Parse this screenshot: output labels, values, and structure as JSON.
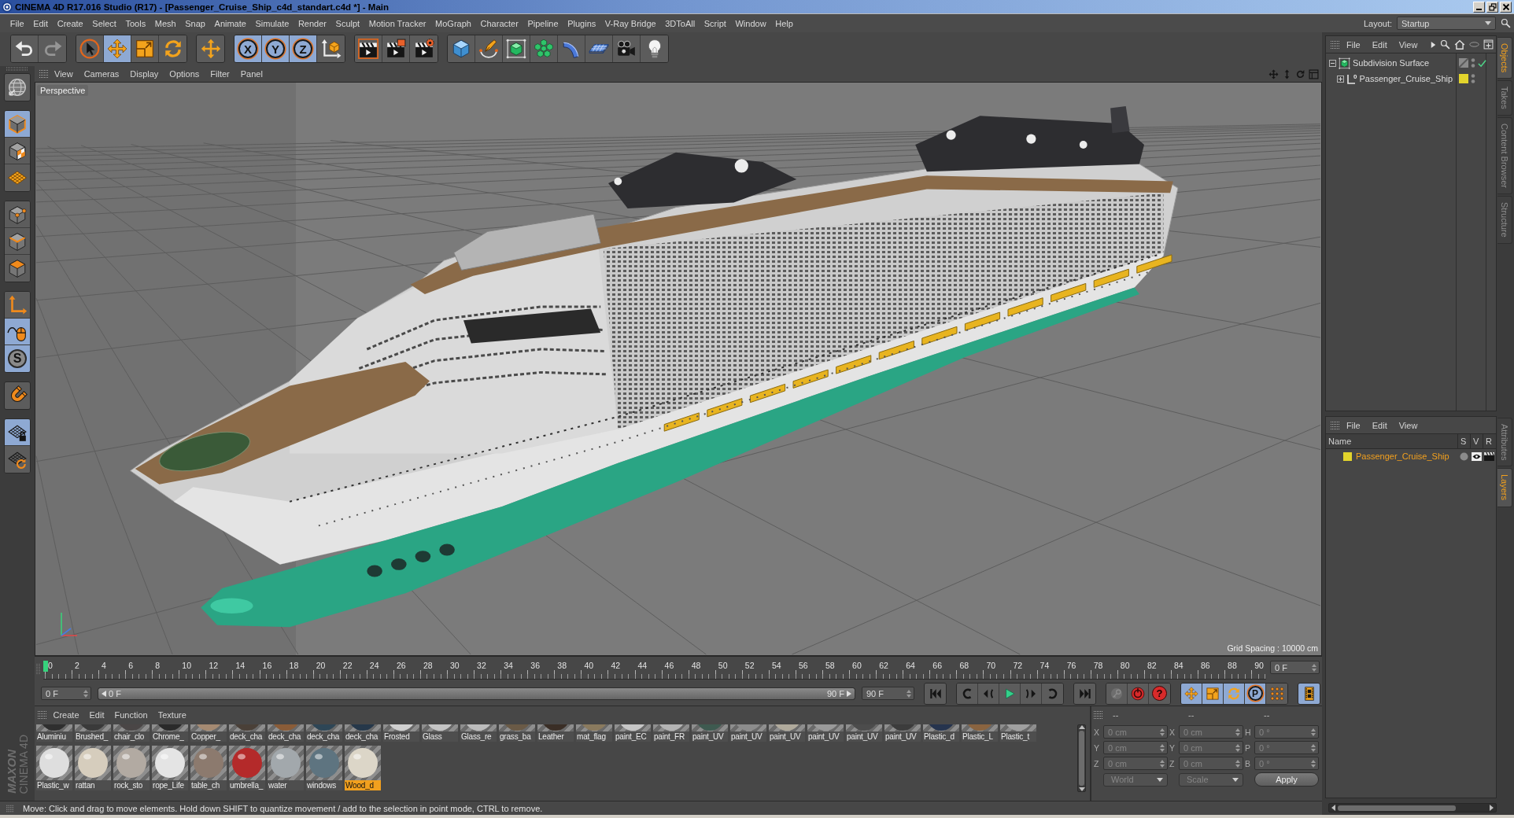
{
  "window": {
    "title": "CINEMA 4D R17.016 Studio (R17) - [Passenger_Cruise_Ship_c4d_standart.c4d *] - Main"
  },
  "menu_bar": {
    "items": [
      "File",
      "Edit",
      "Create",
      "Select",
      "Tools",
      "Mesh",
      "Snap",
      "Animate",
      "Simulate",
      "Render",
      "Sculpt",
      "Motion Tracker",
      "MoGraph",
      "Character",
      "Pipeline",
      "Plugins",
      "V-Ray Bridge",
      "3DToAll",
      "Script",
      "Window",
      "Help"
    ],
    "layout_label": "Layout:",
    "layout_value": "Startup"
  },
  "toolbar": {
    "groups": [
      [
        {
          "kind": "undo",
          "selected": false,
          "disabled": false
        },
        {
          "kind": "redo",
          "selected": false,
          "disabled": true
        }
      ],
      [
        {
          "kind": "select",
          "selected": false,
          "disabled": false
        },
        {
          "kind": "move",
          "selected": true,
          "disabled": false
        },
        {
          "kind": "scale",
          "selected": false,
          "disabled": false
        },
        {
          "kind": "rotate",
          "selected": false,
          "disabled": false
        }
      ],
      [
        {
          "kind": "add",
          "selected": false,
          "disabled": false
        }
      ],
      [
        {
          "kind": "axis",
          "label": "X",
          "selected": true,
          "disabled": false
        },
        {
          "kind": "axis",
          "label": "Y",
          "selected": true,
          "disabled": false
        },
        {
          "kind": "axis",
          "label": "Z",
          "selected": true,
          "disabled": false
        },
        {
          "kind": "coordinates",
          "selected": false,
          "disabled": false
        }
      ],
      [
        {
          "kind": "render-view",
          "selected": false,
          "disabled": false
        },
        {
          "kind": "render-picture",
          "selected": false,
          "disabled": false
        },
        {
          "kind": "render-settings",
          "selected": false,
          "disabled": false
        }
      ],
      [
        {
          "kind": "cube",
          "selected": false,
          "disabled": false
        },
        {
          "kind": "pen",
          "selected": false,
          "disabled": false
        },
        {
          "kind": "subdivision",
          "selected": false,
          "disabled": false
        },
        {
          "kind": "cloner",
          "selected": false,
          "disabled": false
        },
        {
          "kind": "deformer",
          "selected": false,
          "disabled": false
        },
        {
          "kind": "floor",
          "selected": false,
          "disabled": false
        },
        {
          "kind": "camera",
          "selected": false,
          "disabled": false
        },
        {
          "kind": "light",
          "selected": false,
          "disabled": false
        }
      ]
    ]
  },
  "palette": {
    "groups": [
      [
        {
          "kind": "globe",
          "selected": false
        }
      ],
      [
        {
          "kind": "model",
          "selected": true
        },
        {
          "kind": "texture",
          "selected": false
        },
        {
          "kind": "workplane",
          "selected": false
        }
      ],
      [
        {
          "kind": "points",
          "selected": false
        },
        {
          "kind": "edges",
          "selected": false
        },
        {
          "kind": "polygons",
          "selected": false
        }
      ],
      [
        {
          "kind": "axis",
          "selected": false
        },
        {
          "kind": "tweak",
          "selected": true
        },
        {
          "kind": "snap",
          "glyph": "S",
          "selected": true
        }
      ],
      [
        {
          "kind": "magnet",
          "selected": false
        }
      ],
      [
        {
          "kind": "grid-lock",
          "selected": true
        },
        {
          "kind": "grid-rotate",
          "selected": false
        }
      ]
    ],
    "brand": {
      "company": "MAXON",
      "product": "CINEMA 4D"
    }
  },
  "viewport": {
    "menu": [
      "View",
      "Cameras",
      "Display",
      "Options",
      "Filter",
      "Panel"
    ],
    "camera": "Perspective",
    "grid_spacing": "Grid Spacing : 10000 cm"
  },
  "timeline": {
    "ruler": [
      "0",
      "2",
      "4",
      "6",
      "8",
      "10",
      "12",
      "14",
      "16",
      "18",
      "20",
      "22",
      "24",
      "26",
      "28",
      "30",
      "32",
      "34",
      "36",
      "38",
      "40",
      "42",
      "44",
      "46",
      "48",
      "50",
      "52",
      "54",
      "56",
      "58",
      "60",
      "62",
      "64",
      "66",
      "68",
      "70",
      "72",
      "74",
      "76",
      "78",
      "80",
      "82",
      "84",
      "86",
      "88",
      "90"
    ],
    "current_frame": "0 F",
    "start_field": "0 F",
    "range": {
      "start": "0 F",
      "end": "90 F",
      "level": 1
    },
    "end_field": "90 F",
    "transport": [
      [
        {
          "kind": "go-start"
        }
      ],
      [
        {
          "kind": "prev-key"
        },
        {
          "kind": "prev-frame"
        },
        {
          "kind": "play"
        },
        {
          "kind": "next-frame"
        },
        {
          "kind": "next-key"
        }
      ],
      [
        {
          "kind": "go-end"
        }
      ]
    ],
    "record": [
      {
        "kind": "record-key",
        "disabled": true
      },
      {
        "kind": "autokey",
        "disabled": false
      },
      {
        "kind": "question",
        "glyph": "?",
        "disabled": false
      }
    ],
    "key_tracks": [
      {
        "kind": "move",
        "selected": true
      },
      {
        "kind": "scale",
        "selected": true
      },
      {
        "kind": "rotate",
        "selected": true
      },
      {
        "kind": "param",
        "glyph": "P",
        "selected": true
      },
      {
        "kind": "pla",
        "selected": false
      }
    ],
    "timeline_button": {
      "selected": true
    }
  },
  "materials": {
    "menu": [
      "Create",
      "Edit",
      "Function",
      "Texture"
    ],
    "rows": [
      [
        {
          "name": "Aluminiu",
          "color": "#2f2f2f",
          "selected": false
        },
        {
          "name": "Brushed_",
          "color": "#3a3a3a",
          "selected": false
        },
        {
          "name": "chair_clo",
          "color": "#4a4646",
          "selected": false
        },
        {
          "name": "Chrome_",
          "color": "#2a2a2a",
          "selected": false
        },
        {
          "name": "Copper_",
          "color": "#a58a72",
          "selected": false
        },
        {
          "name": "deck_cha",
          "color": "#4a4038",
          "selected": false
        },
        {
          "name": "deck_cha",
          "color": "#8a5c38",
          "selected": false
        },
        {
          "name": "deck_cha",
          "color": "#2e4656",
          "selected": false
        },
        {
          "name": "deck_cha",
          "color": "#26384a",
          "selected": false
        },
        {
          "name": "Frosted",
          "color": "#cfcfcf",
          "selected": false
        },
        {
          "name": "Glass",
          "color": "#c4c4c4",
          "selected": false
        },
        {
          "name": "Glass_re",
          "color": "#bcbcbc",
          "selected": false
        },
        {
          "name": "grass_ba",
          "color": "#6a5a46",
          "selected": false
        },
        {
          "name": "Leather",
          "color": "#3a2e26",
          "selected": false
        },
        {
          "name": "mat_flag",
          "color": "#8a7a5e",
          "selected": false
        },
        {
          "name": "paint_EC",
          "color": "#c6c6c6",
          "selected": false
        },
        {
          "name": "paint_FR",
          "color": "#b4b4b4",
          "selected": false
        },
        {
          "name": "paint_UV",
          "color": "#3e5a50",
          "selected": false
        },
        {
          "name": "paint_UV",
          "color": "#8c8c8c",
          "selected": false
        },
        {
          "name": "paint_UV",
          "color": "#b0aa9c",
          "selected": false
        },
        {
          "name": "paint_UV",
          "color": "#9a9a9a",
          "selected": false
        },
        {
          "name": "paint_UV",
          "color": "#4c4c4c",
          "selected": false
        },
        {
          "name": "paint_UV",
          "color": "#3c3c3c",
          "selected": false
        },
        {
          "name": "Plastic_d",
          "color": "#26344e",
          "selected": false
        },
        {
          "name": "Plastic_L",
          "color": "#8a6440",
          "selected": false
        },
        {
          "name": "Plastic_t",
          "color": "#a0a0a0",
          "selected": false
        }
      ],
      [
        {
          "name": "Plastic_w",
          "color": "#dedede",
          "selected": false
        },
        {
          "name": "rattan",
          "color": "#d6cdbd",
          "selected": false
        },
        {
          "name": "rock_sto",
          "color": "#b2aaa2",
          "selected": false
        },
        {
          "name": "rope_Life",
          "color": "#e4e4e4",
          "selected": false
        },
        {
          "name": "table_ch",
          "color": "#8c7a6e",
          "selected": false
        },
        {
          "name": "umbrella_",
          "color": "#b42a2a",
          "selected": false
        },
        {
          "name": "water",
          "color": "#a2a8ac",
          "selected": false
        },
        {
          "name": "windows",
          "color": "#5e7480",
          "selected": false
        },
        {
          "name": "Wood_d",
          "color": "#dcd6c8",
          "selected": true
        }
      ]
    ]
  },
  "coordinates": {
    "headers": [
      "--",
      "--",
      "--"
    ],
    "disabled": true,
    "rows": [
      [
        {
          "axis": "X",
          "value": "0 cm"
        },
        {
          "axis": "X",
          "value": "0 cm"
        },
        {
          "axis": "H",
          "value": "0 °"
        }
      ],
      [
        {
          "axis": "Y",
          "value": "0 cm"
        },
        {
          "axis": "Y",
          "value": "0 cm"
        },
        {
          "axis": "P",
          "value": "0 °"
        }
      ],
      [
        {
          "axis": "Z",
          "value": "0 cm"
        },
        {
          "axis": "Z",
          "value": "0 cm"
        },
        {
          "axis": "B",
          "value": "0 °"
        }
      ]
    ],
    "space": "World",
    "transform": "Scale",
    "apply": "Apply"
  },
  "status_bar": {
    "text": "Move: Click and drag to move elements. Hold down SHIFT to quantize movement / add to the selection in point mode, CTRL to remove."
  },
  "objects": {
    "menu": [
      "File",
      "Edit",
      "View"
    ],
    "tree": [
      {
        "name": "Subdivision Surface",
        "kind": "subdivision",
        "expanded": true,
        "enabled": true,
        "children": [
          {
            "name": "Passenger_Cruise_Ship",
            "kind": "null",
            "glyph": "0",
            "expanded": false,
            "color": "#e2d42c"
          }
        ]
      }
    ],
    "tabs": [
      {
        "label": "Objects",
        "selected": true
      },
      {
        "label": "Takes",
        "selected": false
      },
      {
        "label": "Content Browser",
        "selected": false
      },
      {
        "label": "Structure",
        "selected": false
      }
    ]
  },
  "layers": {
    "menu": [
      "File",
      "Edit",
      "View"
    ],
    "columns": [
      "Name",
      "S",
      "V",
      "R"
    ],
    "rows": [
      {
        "name": "Passenger_Cruise_Ship",
        "color": "#e2d42c",
        "selected": true,
        "solo": false,
        "visible": true,
        "render": true
      }
    ],
    "tabs": [
      {
        "label": "Attributes",
        "selected": false
      },
      {
        "label": "Layers",
        "selected": true
      }
    ]
  }
}
